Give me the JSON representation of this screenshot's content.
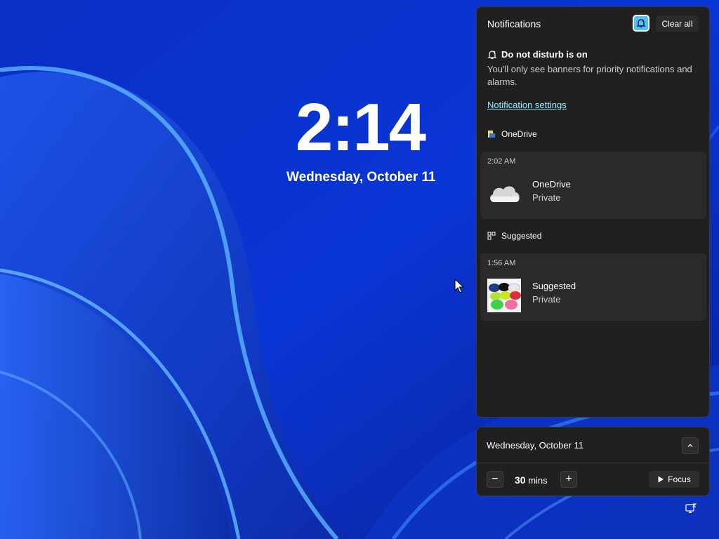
{
  "lock_screen": {
    "time": "2:14",
    "date": "Wednesday, October 11"
  },
  "notification_center": {
    "title": "Notifications",
    "dnd_toggle_icon": "do-not-disturb-icon",
    "clear_all": "Clear all",
    "dnd": {
      "heading": "Do not disturb is on",
      "description": "You'll only see banners for priority notifications and alarms."
    },
    "settings_link": "Notification settings",
    "groups": [
      {
        "app": "OneDrive",
        "icon": "onedrive-app-icon",
        "notification": {
          "time": "2:02 AM",
          "title": "OneDrive",
          "subtitle": "Private",
          "thumbnail": "onedrive-cloud-icon"
        }
      },
      {
        "app": "Suggested",
        "icon": "suggested-app-icon",
        "notification": {
          "time": "1:56 AM",
          "title": "Suggested",
          "subtitle": "Private",
          "thumbnail": "xbox-controllers-image"
        }
      }
    ]
  },
  "calendar_panel": {
    "date": "Wednesday, October 11",
    "focus": {
      "duration_value": "30",
      "duration_unit": "mins",
      "decrease": "−",
      "increase": "+",
      "button_label": "Focus"
    }
  },
  "colors": {
    "accent": "#4cc2ff",
    "link": "#99ebff",
    "panel_bg": "#202020",
    "card_bg": "#2a2a2a"
  }
}
